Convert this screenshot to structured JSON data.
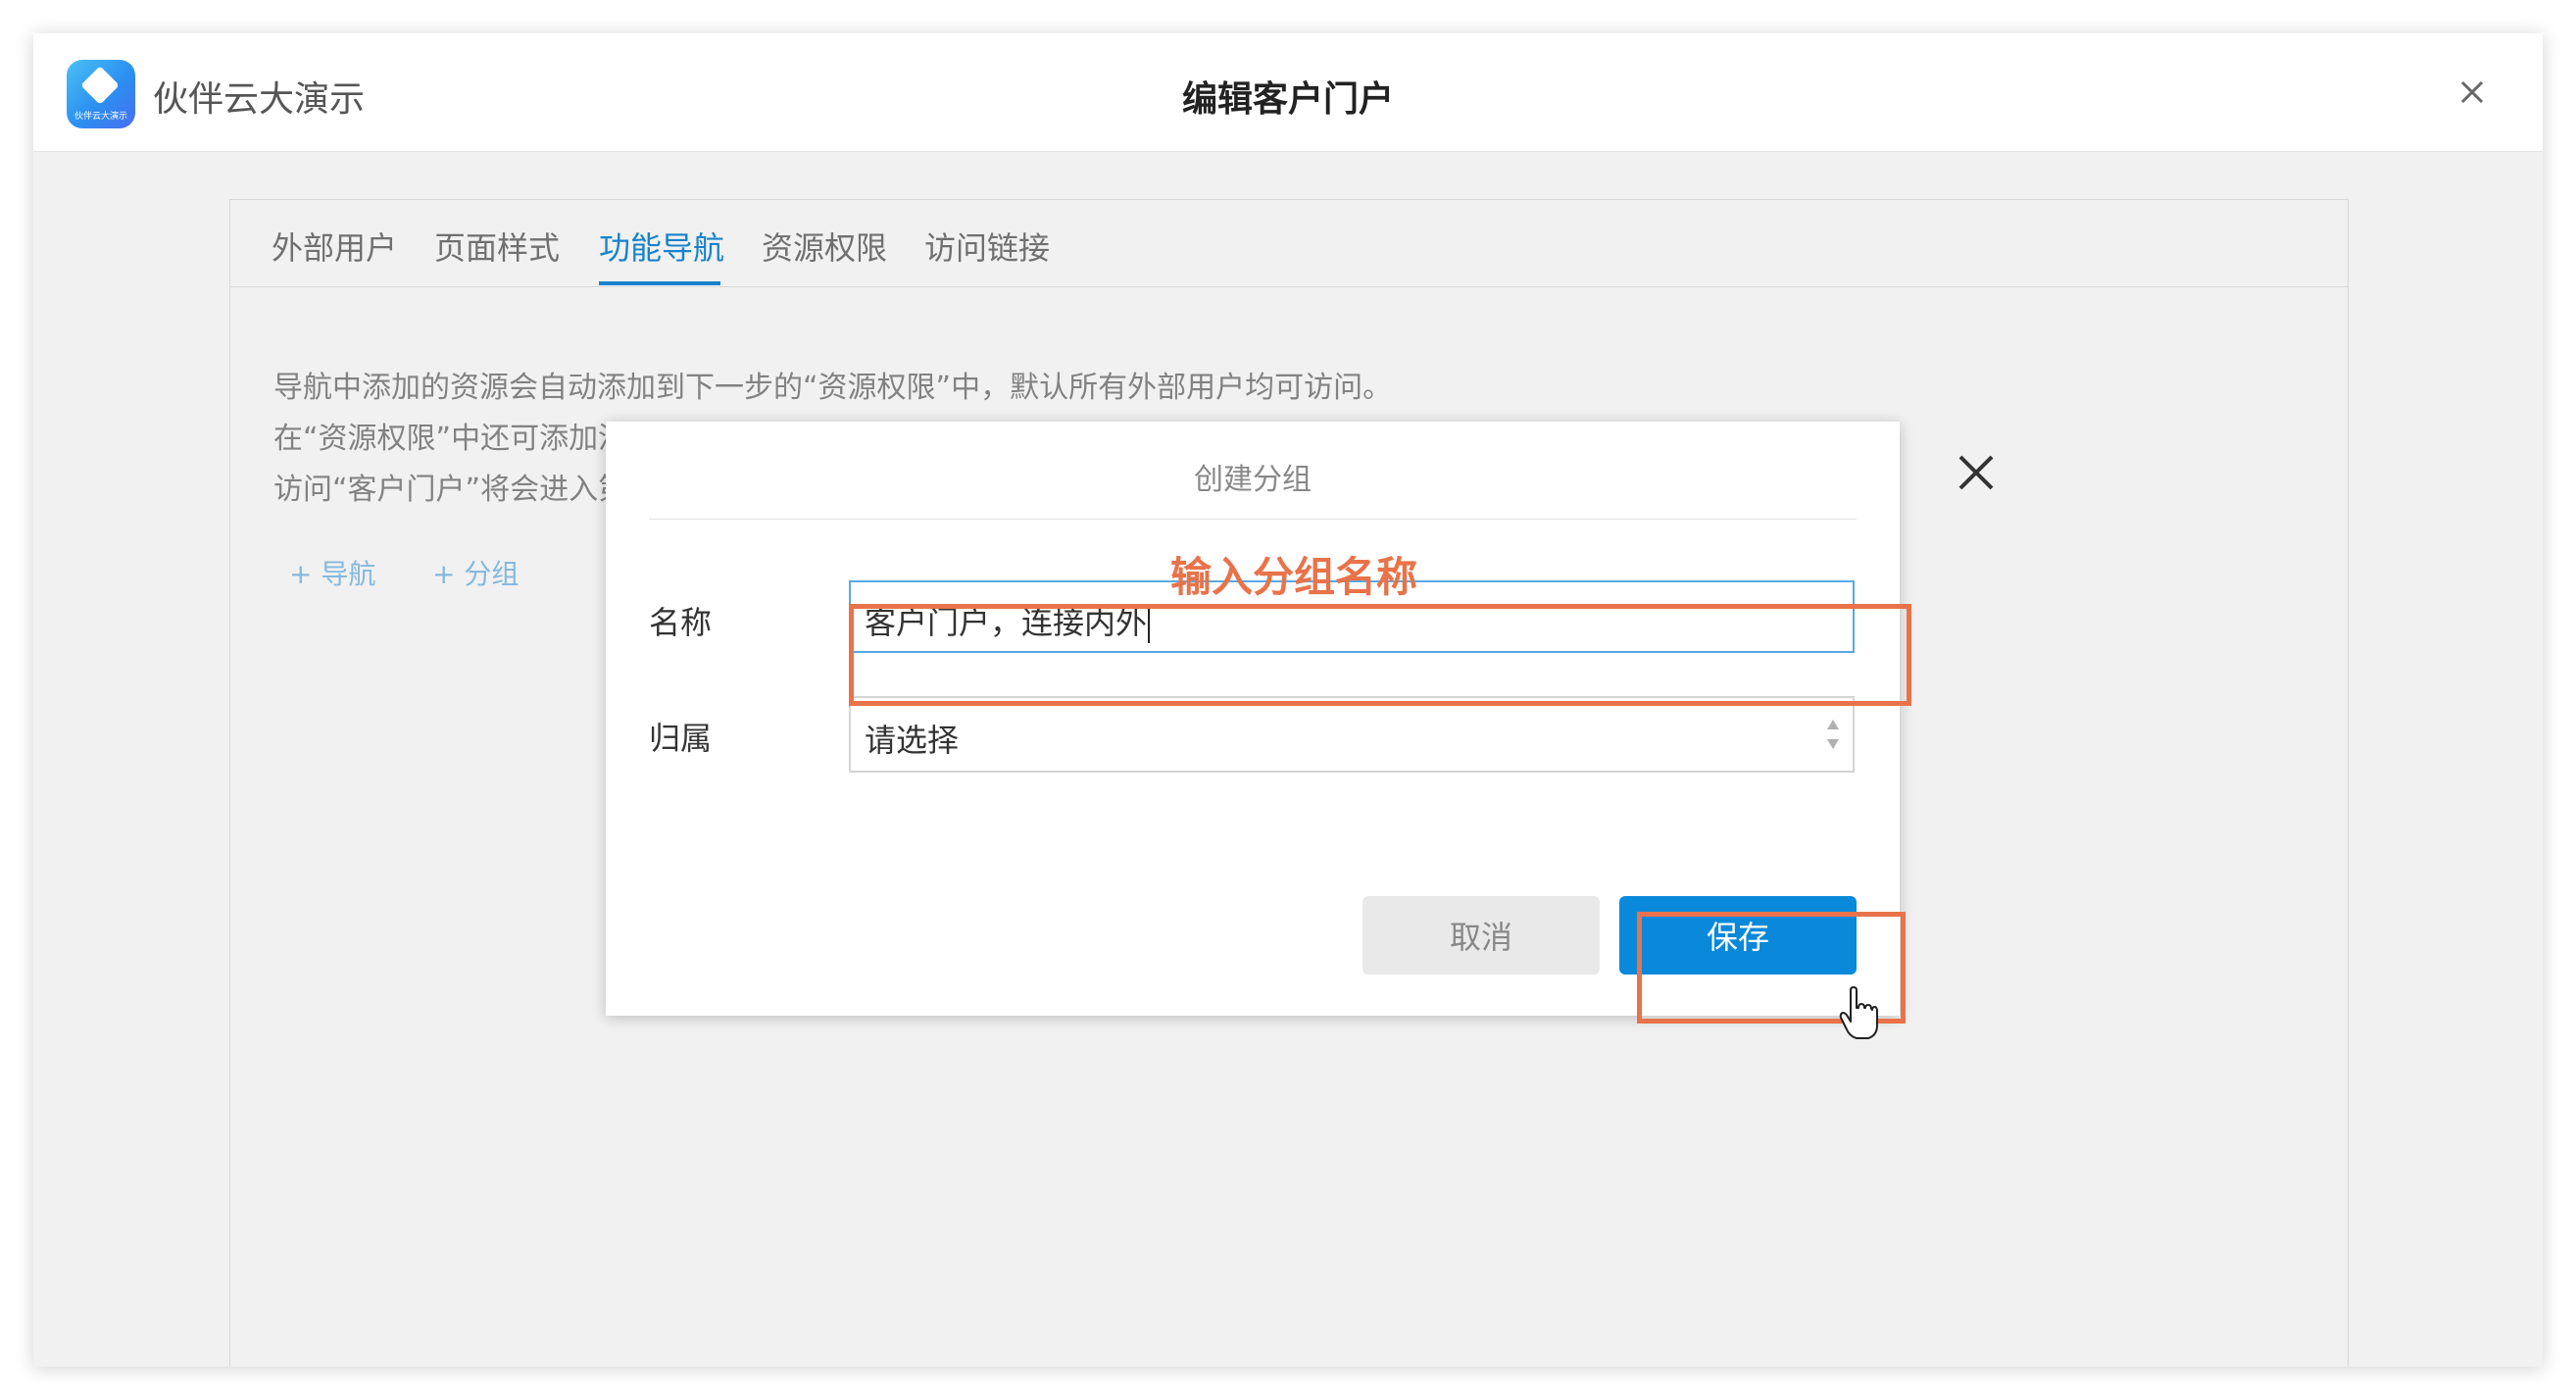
{
  "app": {
    "brand_name": "伙伴云大演示",
    "logo_text": "伙伴云大演示",
    "page_title": "编辑客户门户"
  },
  "tabs": [
    {
      "label": "外部用户",
      "active": false
    },
    {
      "label": "页面样式",
      "active": false
    },
    {
      "label": "功能导航",
      "active": true
    },
    {
      "label": "资源权限",
      "active": false
    },
    {
      "label": "访问链接",
      "active": false
    }
  ],
  "description": {
    "line1": "导航中添加的资源会自动添加到下一步的“资源权限”中，默认所有外部用户均可访问。",
    "line2": "在“资源权限”中还可添加没有通过导航直接访问的资源，例如可通过数据的关联、子表、仪表盘的组件等间接访问的资源。",
    "line3": "访问“客户门户”将会进入第一个导航，没有可访问的导航的分组，以及无权访问的资源的导航将不会显示。"
  },
  "actions": {
    "add_nav": "+ 导航",
    "add_group": "+ 分组"
  },
  "dialog": {
    "title": "创建分组",
    "name_label": "名称",
    "name_value": "客户门户，连接内外",
    "belong_label": "归属",
    "belong_placeholder": "请选择",
    "cancel_label": "取消",
    "save_label": "保存"
  },
  "annotation": {
    "text": "输入分组名称",
    "color": "#e8734a"
  },
  "colors": {
    "accent": "#1a8ad8",
    "save_button": "#0a88da",
    "annotation": "#e8734a"
  }
}
